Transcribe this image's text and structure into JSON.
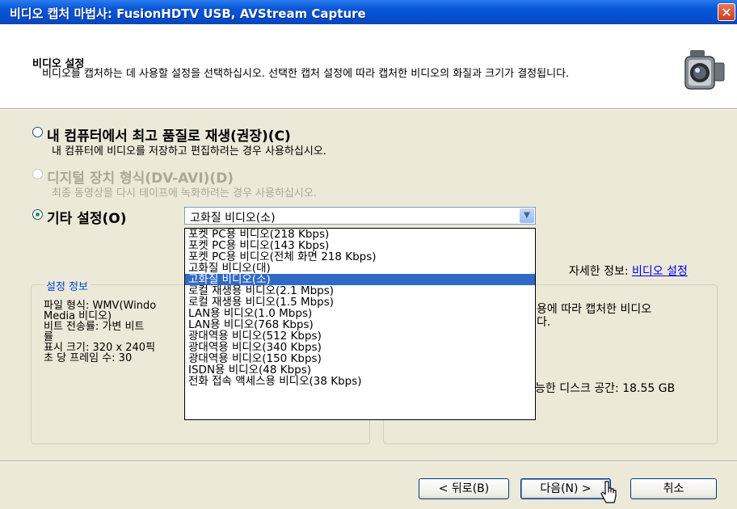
{
  "window": {
    "title": "비디오 캡처 마법사: FusionHDTV USB, AVStream Capture",
    "close_glyph": "✕"
  },
  "header": {
    "title": "비디오 설정",
    "description": "비디오를 캡처하는 데 사용할 설정을 선택하십시오. 선택한 캡처 설정에 따라 캡처한 비디오의 화질과 크기가 결정됩니다.",
    "icon": "camcorder-icon"
  },
  "options": [
    {
      "label": "내 컴퓨터에서 최고 품질로 재생(권장)(C)",
      "description": "내 컴퓨터에 비디오를 저장하고 편집하려는 경우 사용하십시오.",
      "checked": false,
      "disabled": false
    },
    {
      "label": "디지털 장치 형식(DV-AVI)(D)",
      "description": "최종 동영상을 다시 테이프에 녹화하려는 경우 사용하십시오.",
      "checked": false,
      "disabled": true
    },
    {
      "label": "기타 설정(O)",
      "checked": true,
      "disabled": false
    }
  ],
  "combo": {
    "value": "고화질 비디오(소)"
  },
  "dropdown": {
    "items": [
      "포켓 PC용 비디오(218 Kbps)",
      "포켓 PC용 비디오(143 Kbps)",
      "포켓 PC용 비디오(전체 화면 218 Kbps)",
      "고화질 비디오(대)",
      "고화질 비디오(소)",
      "로컬 재생용 비디오(2.1 Mbps)",
      "로컬 재생용 비디오(1.5 Mbps)",
      "LAN용 비디오(1.0 Mbps)",
      "LAN용 비디오(768 Kbps)",
      "광대역용 비디오(512 Kbps)",
      "광대역용 비디오(340 Kbps)",
      "광대역용 비디오(150 Kbps)",
      "ISDN용 비디오(48 Kbps)",
      "전화 접속 액세스용 비디오(38 Kbps)"
    ],
    "selected_index": 4
  },
  "details": {
    "prefix": "자세한 정보: ",
    "link": "비디오 설정"
  },
  "setting_info": {
    "legend": "설정 정보",
    "lines": [
      "파일 형식: WMV(Windo",
      "Media 비디오)",
      "비트 전송률: 가변 비트",
      "률",
      "표시 크기: 320 x 240픽",
      "초 당 프레임 수: 30"
    ]
  },
  "right_info": {
    "line1": "용에 따라 캡처한 비디오",
    "line2": "다.",
    "disk": "능한 디스크 공간: 18.55 GB"
  },
  "buttons": {
    "back": "< 뒤로(B)",
    "next": "다음(N) >",
    "cancel": "취소"
  },
  "colors": {
    "selection": "#316ac5",
    "title_bar": "#0450d0",
    "link": "#0000ee",
    "legend": "#0046d5"
  }
}
